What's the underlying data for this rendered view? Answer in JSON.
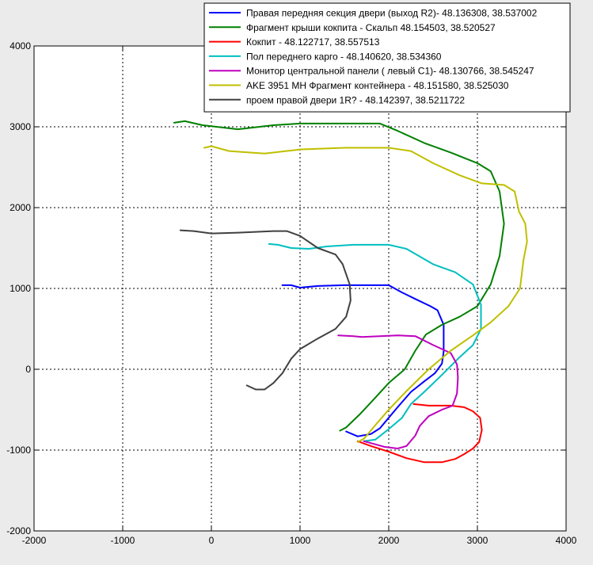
{
  "chart_data": {
    "type": "line",
    "xlim": [
      -2000,
      4000
    ],
    "ylim": [
      -2000,
      4000
    ],
    "x_ticks": [
      -2000,
      -1000,
      0,
      1000,
      2000,
      3000,
      4000
    ],
    "y_ticks": [
      -2000,
      -1000,
      0,
      1000,
      2000,
      3000,
      4000
    ],
    "grid": true,
    "legend_position": "top-right",
    "series": [
      {
        "name": "Правая передняя секция двери (выход R2)- 48.136308, 38.537002",
        "color": "#0000ff",
        "points": [
          [
            800,
            1040
          ],
          [
            900,
            1040
          ],
          [
            1000,
            1010
          ],
          [
            1200,
            1030
          ],
          [
            1500,
            1040
          ],
          [
            1800,
            1040
          ],
          [
            2000,
            1040
          ],
          [
            2150,
            950
          ],
          [
            2300,
            870
          ],
          [
            2470,
            780
          ],
          [
            2550,
            730
          ],
          [
            2620,
            550
          ],
          [
            2620,
            400
          ],
          [
            2620,
            220
          ],
          [
            2600,
            70
          ],
          [
            2520,
            -50
          ],
          [
            2400,
            -150
          ],
          [
            2250,
            -280
          ],
          [
            2100,
            -470
          ],
          [
            2000,
            -600
          ],
          [
            1900,
            -730
          ],
          [
            1800,
            -800
          ],
          [
            1650,
            -830
          ],
          [
            1520,
            -770
          ]
        ]
      },
      {
        "name": "Фрагмент крыши кокпита - Скальп 48.154503, 38.520527",
        "color": "#008000",
        "points": [
          [
            -420,
            3050
          ],
          [
            -300,
            3070
          ],
          [
            -100,
            3020
          ],
          [
            300,
            2970
          ],
          [
            700,
            3020
          ],
          [
            1000,
            3040
          ],
          [
            1500,
            3040
          ],
          [
            1900,
            3040
          ],
          [
            2100,
            2950
          ],
          [
            2400,
            2800
          ],
          [
            2700,
            2680
          ],
          [
            3000,
            2550
          ],
          [
            3150,
            2450
          ],
          [
            3250,
            2200
          ],
          [
            3300,
            1800
          ],
          [
            3250,
            1400
          ],
          [
            3150,
            1050
          ],
          [
            3000,
            780
          ],
          [
            2800,
            650
          ],
          [
            2600,
            550
          ],
          [
            2420,
            430
          ],
          [
            2300,
            230
          ],
          [
            2180,
            0
          ],
          [
            2000,
            -170
          ],
          [
            1850,
            -350
          ],
          [
            1680,
            -550
          ],
          [
            1520,
            -720
          ],
          [
            1450,
            -760
          ]
        ]
      },
      {
        "name": "Кокпит - 48.122717, 38.557513",
        "color": "#ff0000",
        "points": [
          [
            2280,
            -430
          ],
          [
            2450,
            -450
          ],
          [
            2700,
            -450
          ],
          [
            2850,
            -470
          ],
          [
            2950,
            -520
          ],
          [
            3030,
            -600
          ],
          [
            3050,
            -750
          ],
          [
            3020,
            -900
          ],
          [
            2950,
            -980
          ],
          [
            2850,
            -1050
          ],
          [
            2750,
            -1110
          ],
          [
            2600,
            -1150
          ],
          [
            2400,
            -1150
          ],
          [
            2200,
            -1100
          ],
          [
            2000,
            -1020
          ],
          [
            1800,
            -950
          ],
          [
            1650,
            -890
          ]
        ]
      },
      {
        "name": "Пол переднего карго - 48.140620, 38.534360",
        "color": "#00bfbf",
        "points": [
          [
            650,
            1550
          ],
          [
            750,
            1540
          ],
          [
            900,
            1500
          ],
          [
            1100,
            1490
          ],
          [
            1300,
            1520
          ],
          [
            1600,
            1540
          ],
          [
            2000,
            1540
          ],
          [
            2200,
            1490
          ],
          [
            2500,
            1300
          ],
          [
            2750,
            1200
          ],
          [
            2950,
            1050
          ],
          [
            3040,
            800
          ],
          [
            3040,
            500
          ],
          [
            2950,
            300
          ],
          [
            2800,
            150
          ],
          [
            2600,
            -70
          ],
          [
            2400,
            -280
          ],
          [
            2250,
            -430
          ],
          [
            2150,
            -600
          ],
          [
            2000,
            -740
          ],
          [
            1850,
            -870
          ],
          [
            1720,
            -890
          ]
        ]
      },
      {
        "name": "Монитор центральной панели ( левый С1)- 48.130766, 38.545247",
        "color": "#bf00bf",
        "points": [
          [
            1430,
            420
          ],
          [
            1600,
            410
          ],
          [
            1700,
            400
          ],
          [
            1900,
            410
          ],
          [
            2100,
            420
          ],
          [
            2300,
            410
          ],
          [
            2500,
            300
          ],
          [
            2700,
            200
          ],
          [
            2770,
            60
          ],
          [
            2780,
            -100
          ],
          [
            2770,
            -300
          ],
          [
            2720,
            -450
          ],
          [
            2600,
            -500
          ],
          [
            2450,
            -580
          ],
          [
            2350,
            -700
          ],
          [
            2300,
            -820
          ],
          [
            2200,
            -950
          ],
          [
            2100,
            -980
          ],
          [
            1950,
            -960
          ],
          [
            1820,
            -920
          ],
          [
            1720,
            -890
          ]
        ]
      },
      {
        "name": "AKE 3951 MH Фрагмент контейнера - 48.151580, 38.525030",
        "color": "#bfbf00",
        "points": [
          [
            -80,
            2740
          ],
          [
            0,
            2760
          ],
          [
            200,
            2700
          ],
          [
            600,
            2670
          ],
          [
            1000,
            2720
          ],
          [
            1500,
            2740
          ],
          [
            2000,
            2740
          ],
          [
            2250,
            2700
          ],
          [
            2500,
            2550
          ],
          [
            2800,
            2400
          ],
          [
            3050,
            2300
          ],
          [
            3300,
            2280
          ],
          [
            3420,
            2200
          ],
          [
            3470,
            1950
          ],
          [
            3540,
            1800
          ],
          [
            3560,
            1580
          ],
          [
            3520,
            1350
          ],
          [
            3480,
            1000
          ],
          [
            3350,
            780
          ],
          [
            3150,
            580
          ],
          [
            2950,
            420
          ],
          [
            2700,
            230
          ],
          [
            2450,
            0
          ],
          [
            2200,
            -270
          ],
          [
            2000,
            -500
          ],
          [
            1850,
            -690
          ],
          [
            1720,
            -860
          ],
          [
            1650,
            -900
          ]
        ]
      },
      {
        "name": "проем правой двери 1R? - 48.142397, 38.5211722",
        "color": "#404040",
        "points": [
          [
            -350,
            1720
          ],
          [
            -200,
            1710
          ],
          [
            0,
            1680
          ],
          [
            300,
            1690
          ],
          [
            700,
            1710
          ],
          [
            850,
            1710
          ],
          [
            1000,
            1650
          ],
          [
            1200,
            1500
          ],
          [
            1400,
            1420
          ],
          [
            1480,
            1300
          ],
          [
            1560,
            1050
          ],
          [
            1570,
            850
          ],
          [
            1520,
            650
          ],
          [
            1400,
            500
          ],
          [
            1200,
            380
          ],
          [
            1000,
            250
          ],
          [
            900,
            130
          ],
          [
            800,
            -50
          ],
          [
            700,
            -170
          ],
          [
            600,
            -250
          ],
          [
            500,
            -250
          ],
          [
            400,
            -200
          ]
        ]
      }
    ]
  }
}
